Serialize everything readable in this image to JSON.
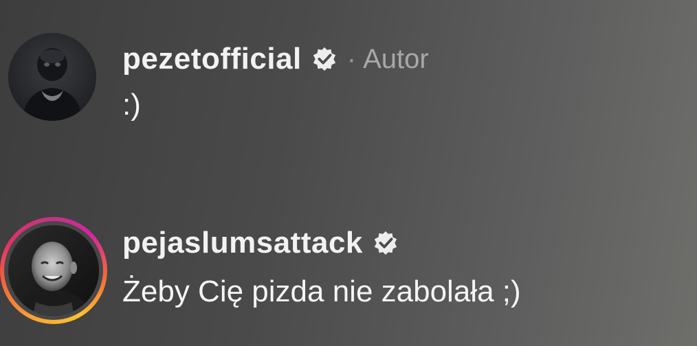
{
  "comments": [
    {
      "username": "pezetofficial",
      "verified": true,
      "separator": "·",
      "role": "Autor",
      "text": ":)",
      "avatar_icon": "avatar-dark-figure",
      "has_story_ring": false
    },
    {
      "username": "pejaslumsattack",
      "verified": true,
      "text": "Żeby Cię pizda nie zabolała ;)",
      "avatar_icon": "avatar-man-photo",
      "has_story_ring": true
    }
  ],
  "colors": {
    "username": "#f2f2f2",
    "text": "#f5f5f5",
    "role": "#a8a8a8",
    "story_ring": [
      "#fdc12f",
      "#f26b3a",
      "#e1306c",
      "#c13584"
    ]
  }
}
